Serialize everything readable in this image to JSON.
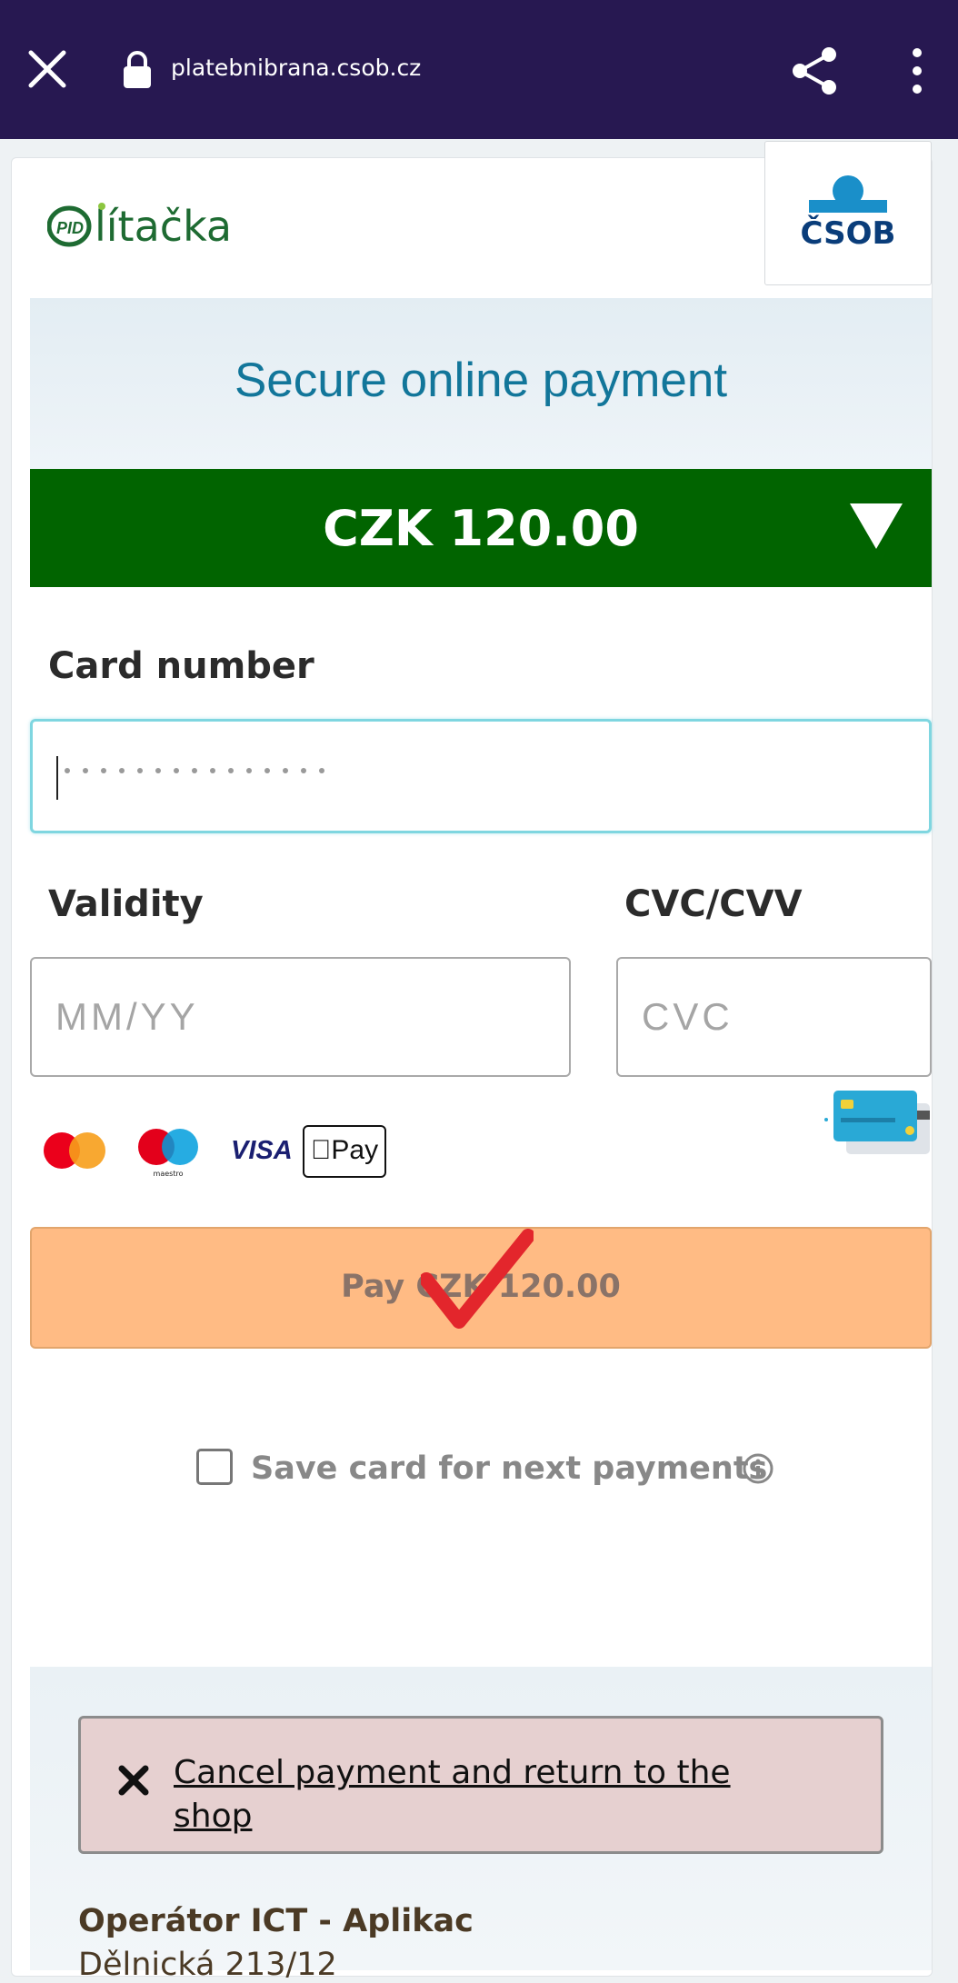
{
  "browser": {
    "url": "platebnibrana.csob.cz",
    "icons": [
      "close-icon",
      "lock-icon",
      "share-icon",
      "more-vert-icon"
    ]
  },
  "merchant": {
    "logo_text": "lítačka",
    "bank_logo_text": "ČSOB"
  },
  "header": {
    "title": "Secure online payment",
    "amount": "CZK 120.00"
  },
  "form": {
    "card_number_label": "Card number",
    "card_number_value": "",
    "validity_label": "Validity",
    "validity_placeholder": "MM/YY",
    "cvc_label": "CVC/CVV",
    "cvc_placeholder": "CVC"
  },
  "card_brands": {
    "visa": "VISA",
    "apple_pay": "Pay",
    "icons": [
      "mastercard-icon",
      "maestro-icon",
      "visa-icon",
      "apple-pay-icon",
      "card-cvc-illustration"
    ]
  },
  "pay_button": {
    "label": "Pay CZK 120.00"
  },
  "save_card": {
    "label": "Save card for next payments",
    "checked": false
  },
  "cancel": {
    "label": "Cancel payment and return to the shop"
  },
  "footer": {
    "operator": "Operátor ICT - Aplikac",
    "address": "Dělnická 213/12"
  },
  "colors": {
    "topbar": "#271851",
    "amount_bar": "#016400",
    "title": "#12769a",
    "pay_button": "#ffbb84",
    "cancel_box": "#e6d0d0"
  }
}
